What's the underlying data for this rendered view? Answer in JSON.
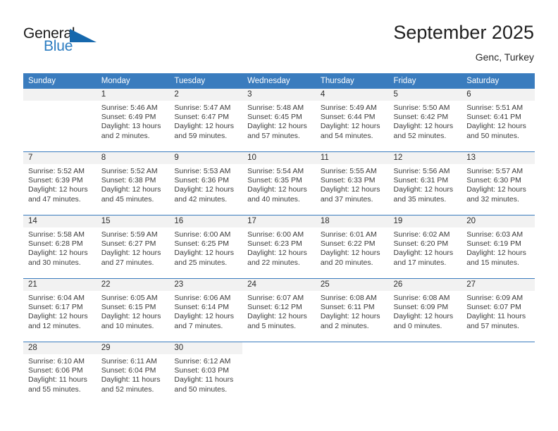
{
  "brand": {
    "name_part1": "General",
    "name_part2": "Blue",
    "triangle_icon": "triangle-icon",
    "color_primary": "#2b7cc1",
    "color_dark": "#1a1a1a"
  },
  "header": {
    "title": "September 2025",
    "location": "Genc, Turkey"
  },
  "calendar": {
    "header_bg": "#3a7cbe",
    "daynum_bg": "#f2f2f2",
    "grid_line": "#3a7cbe",
    "weekday_headers": [
      "Sunday",
      "Monday",
      "Tuesday",
      "Wednesday",
      "Thursday",
      "Friday",
      "Saturday"
    ],
    "weeks": [
      [
        {
          "day": "",
          "blank": true,
          "shaded": true,
          "sunrise": "",
          "sunset": "",
          "daylight_line1": "",
          "daylight_line2": ""
        },
        {
          "day": "1",
          "sunrise": "Sunrise: 5:46 AM",
          "sunset": "Sunset: 6:49 PM",
          "daylight_line1": "Daylight: 13 hours",
          "daylight_line2": "and 2 minutes."
        },
        {
          "day": "2",
          "sunrise": "Sunrise: 5:47 AM",
          "sunset": "Sunset: 6:47 PM",
          "daylight_line1": "Daylight: 12 hours",
          "daylight_line2": "and 59 minutes."
        },
        {
          "day": "3",
          "sunrise": "Sunrise: 5:48 AM",
          "sunset": "Sunset: 6:45 PM",
          "daylight_line1": "Daylight: 12 hours",
          "daylight_line2": "and 57 minutes."
        },
        {
          "day": "4",
          "sunrise": "Sunrise: 5:49 AM",
          "sunset": "Sunset: 6:44 PM",
          "daylight_line1": "Daylight: 12 hours",
          "daylight_line2": "and 54 minutes."
        },
        {
          "day": "5",
          "sunrise": "Sunrise: 5:50 AM",
          "sunset": "Sunset: 6:42 PM",
          "daylight_line1": "Daylight: 12 hours",
          "daylight_line2": "and 52 minutes."
        },
        {
          "day": "6",
          "sunrise": "Sunrise: 5:51 AM",
          "sunset": "Sunset: 6:41 PM",
          "daylight_line1": "Daylight: 12 hours",
          "daylight_line2": "and 50 minutes."
        }
      ],
      [
        {
          "day": "7",
          "sunrise": "Sunrise: 5:52 AM",
          "sunset": "Sunset: 6:39 PM",
          "daylight_line1": "Daylight: 12 hours",
          "daylight_line2": "and 47 minutes."
        },
        {
          "day": "8",
          "sunrise": "Sunrise: 5:52 AM",
          "sunset": "Sunset: 6:38 PM",
          "daylight_line1": "Daylight: 12 hours",
          "daylight_line2": "and 45 minutes."
        },
        {
          "day": "9",
          "sunrise": "Sunrise: 5:53 AM",
          "sunset": "Sunset: 6:36 PM",
          "daylight_line1": "Daylight: 12 hours",
          "daylight_line2": "and 42 minutes."
        },
        {
          "day": "10",
          "sunrise": "Sunrise: 5:54 AM",
          "sunset": "Sunset: 6:35 PM",
          "daylight_line1": "Daylight: 12 hours",
          "daylight_line2": "and 40 minutes."
        },
        {
          "day": "11",
          "sunrise": "Sunrise: 5:55 AM",
          "sunset": "Sunset: 6:33 PM",
          "daylight_line1": "Daylight: 12 hours",
          "daylight_line2": "and 37 minutes."
        },
        {
          "day": "12",
          "sunrise": "Sunrise: 5:56 AM",
          "sunset": "Sunset: 6:31 PM",
          "daylight_line1": "Daylight: 12 hours",
          "daylight_line2": "and 35 minutes."
        },
        {
          "day": "13",
          "sunrise": "Sunrise: 5:57 AM",
          "sunset": "Sunset: 6:30 PM",
          "daylight_line1": "Daylight: 12 hours",
          "daylight_line2": "and 32 minutes."
        }
      ],
      [
        {
          "day": "14",
          "sunrise": "Sunrise: 5:58 AM",
          "sunset": "Sunset: 6:28 PM",
          "daylight_line1": "Daylight: 12 hours",
          "daylight_line2": "and 30 minutes."
        },
        {
          "day": "15",
          "sunrise": "Sunrise: 5:59 AM",
          "sunset": "Sunset: 6:27 PM",
          "daylight_line1": "Daylight: 12 hours",
          "daylight_line2": "and 27 minutes."
        },
        {
          "day": "16",
          "sunrise": "Sunrise: 6:00 AM",
          "sunset": "Sunset: 6:25 PM",
          "daylight_line1": "Daylight: 12 hours",
          "daylight_line2": "and 25 minutes."
        },
        {
          "day": "17",
          "sunrise": "Sunrise: 6:00 AM",
          "sunset": "Sunset: 6:23 PM",
          "daylight_line1": "Daylight: 12 hours",
          "daylight_line2": "and 22 minutes."
        },
        {
          "day": "18",
          "sunrise": "Sunrise: 6:01 AM",
          "sunset": "Sunset: 6:22 PM",
          "daylight_line1": "Daylight: 12 hours",
          "daylight_line2": "and 20 minutes."
        },
        {
          "day": "19",
          "sunrise": "Sunrise: 6:02 AM",
          "sunset": "Sunset: 6:20 PM",
          "daylight_line1": "Daylight: 12 hours",
          "daylight_line2": "and 17 minutes."
        },
        {
          "day": "20",
          "sunrise": "Sunrise: 6:03 AM",
          "sunset": "Sunset: 6:19 PM",
          "daylight_line1": "Daylight: 12 hours",
          "daylight_line2": "and 15 minutes."
        }
      ],
      [
        {
          "day": "21",
          "sunrise": "Sunrise: 6:04 AM",
          "sunset": "Sunset: 6:17 PM",
          "daylight_line1": "Daylight: 12 hours",
          "daylight_line2": "and 12 minutes."
        },
        {
          "day": "22",
          "sunrise": "Sunrise: 6:05 AM",
          "sunset": "Sunset: 6:15 PM",
          "daylight_line1": "Daylight: 12 hours",
          "daylight_line2": "and 10 minutes."
        },
        {
          "day": "23",
          "sunrise": "Sunrise: 6:06 AM",
          "sunset": "Sunset: 6:14 PM",
          "daylight_line1": "Daylight: 12 hours",
          "daylight_line2": "and 7 minutes."
        },
        {
          "day": "24",
          "sunrise": "Sunrise: 6:07 AM",
          "sunset": "Sunset: 6:12 PM",
          "daylight_line1": "Daylight: 12 hours",
          "daylight_line2": "and 5 minutes."
        },
        {
          "day": "25",
          "sunrise": "Sunrise: 6:08 AM",
          "sunset": "Sunset: 6:11 PM",
          "daylight_line1": "Daylight: 12 hours",
          "daylight_line2": "and 2 minutes."
        },
        {
          "day": "26",
          "sunrise": "Sunrise: 6:08 AM",
          "sunset": "Sunset: 6:09 PM",
          "daylight_line1": "Daylight: 12 hours",
          "daylight_line2": "and 0 minutes."
        },
        {
          "day": "27",
          "sunrise": "Sunrise: 6:09 AM",
          "sunset": "Sunset: 6:07 PM",
          "daylight_line1": "Daylight: 11 hours",
          "daylight_line2": "and 57 minutes."
        }
      ],
      [
        {
          "day": "28",
          "sunrise": "Sunrise: 6:10 AM",
          "sunset": "Sunset: 6:06 PM",
          "daylight_line1": "Daylight: 11 hours",
          "daylight_line2": "and 55 minutes."
        },
        {
          "day": "29",
          "sunrise": "Sunrise: 6:11 AM",
          "sunset": "Sunset: 6:04 PM",
          "daylight_line1": "Daylight: 11 hours",
          "daylight_line2": "and 52 minutes."
        },
        {
          "day": "30",
          "sunrise": "Sunrise: 6:12 AM",
          "sunset": "Sunset: 6:03 PM",
          "daylight_line1": "Daylight: 11 hours",
          "daylight_line2": "and 50 minutes."
        },
        {
          "day": "",
          "blank": true,
          "sunrise": "",
          "sunset": "",
          "daylight_line1": "",
          "daylight_line2": ""
        },
        {
          "day": "",
          "blank": true,
          "sunrise": "",
          "sunset": "",
          "daylight_line1": "",
          "daylight_line2": ""
        },
        {
          "day": "",
          "blank": true,
          "sunrise": "",
          "sunset": "",
          "daylight_line1": "",
          "daylight_line2": ""
        },
        {
          "day": "",
          "blank": true,
          "sunrise": "",
          "sunset": "",
          "daylight_line1": "",
          "daylight_line2": ""
        }
      ]
    ]
  }
}
